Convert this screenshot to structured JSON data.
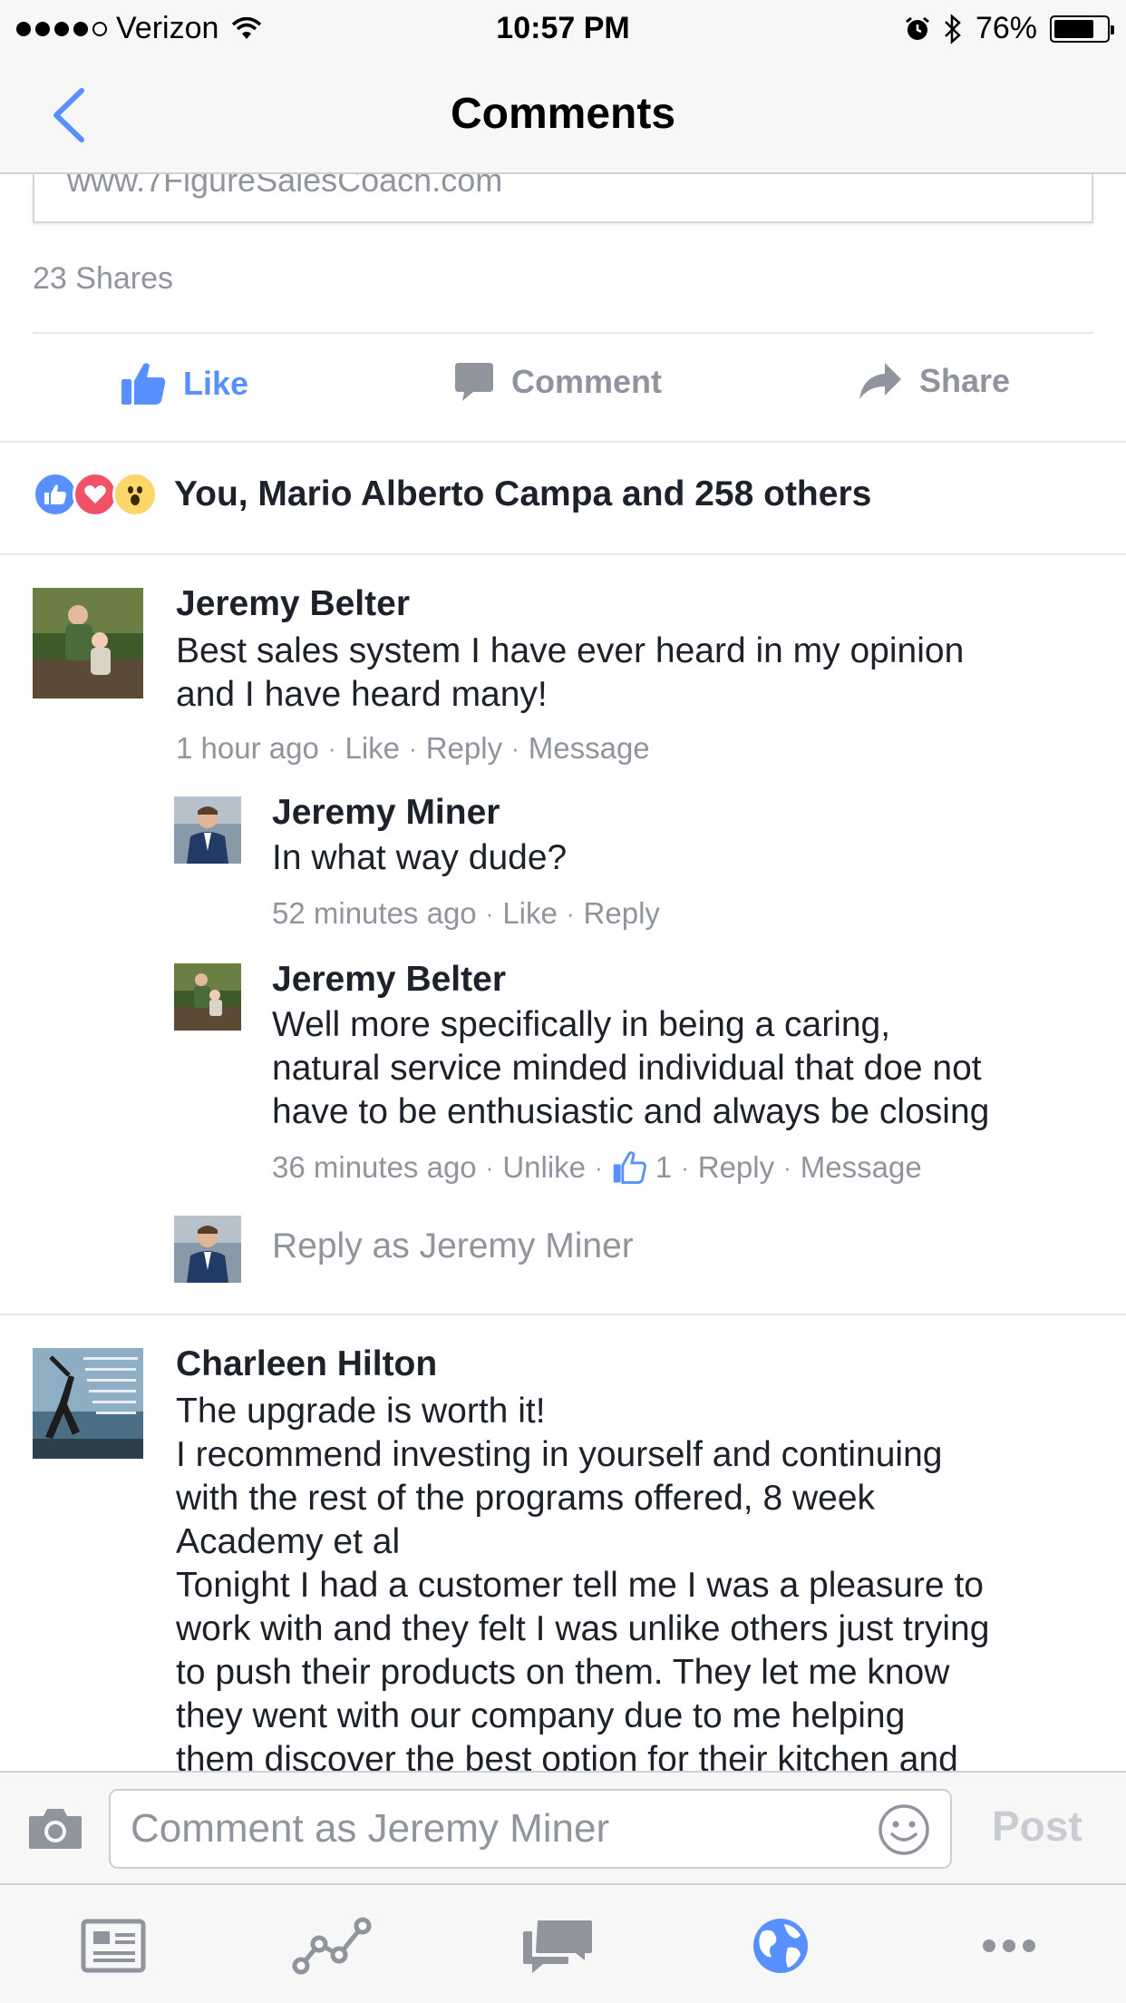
{
  "status_bar": {
    "carrier": "Verizon",
    "time": "10:57 PM",
    "battery": "76%",
    "battery_level": 0.76
  },
  "nav": {
    "title": "Comments"
  },
  "post": {
    "link_text": "www.7FigureSalesCoach.com",
    "shares": "23 Shares",
    "actions": {
      "like": "Like",
      "comment": "Comment",
      "share": "Share"
    },
    "reactions_text": "You, Mario Alberto Campa and 258 others"
  },
  "comments": [
    {
      "author": "Jeremy Belter",
      "lines": [
        "Best sales system I have ever heard in my opinion",
        "and I have heard many!"
      ],
      "meta": {
        "time": "1 hour ago",
        "like": "Like",
        "reply": "Reply",
        "message": "Message"
      },
      "replies": [
        {
          "author": "Jeremy Miner",
          "lines": [
            "In what way dude?"
          ],
          "meta": {
            "time": "52 minutes ago",
            "like": "Like",
            "reply": "Reply"
          }
        },
        {
          "author": "Jeremy Belter",
          "lines": [
            "Well more specifically in being a caring,",
            "natural service minded individual that doe not",
            "have to be enthusiastic and always be closing"
          ],
          "meta": {
            "time": "36 minutes ago",
            "unlike": "Unlike",
            "like_count": "1",
            "reply": "Reply",
            "message": "Message"
          }
        }
      ],
      "reply_as": "Reply as Jeremy Miner"
    },
    {
      "author": "Charleen Hilton",
      "lines": [
        "The upgrade is worth it!",
        "I recommend investing in yourself and continuing",
        "with the rest of the programs offered, 8 week",
        "Academy et al",
        "Tonight I had a customer tell me I was a pleasure to",
        "work with and they felt I was unlike others just trying",
        "to push their products on them. They let me know",
        "they went with our company due to me helping",
        "them discover the best option for their kitchen and"
      ]
    }
  ],
  "composer": {
    "placeholder": "Comment as Jeremy Miner",
    "post_label": "Post"
  },
  "colors": {
    "accent": "#5890ff",
    "muted": "#90949c",
    "text": "#1d2129",
    "love": "#f25268",
    "wow": "#fcd669"
  },
  "tabs": [
    "news-feed-icon",
    "activity-icon",
    "messages-icon",
    "globe-icon",
    "more-icon"
  ]
}
